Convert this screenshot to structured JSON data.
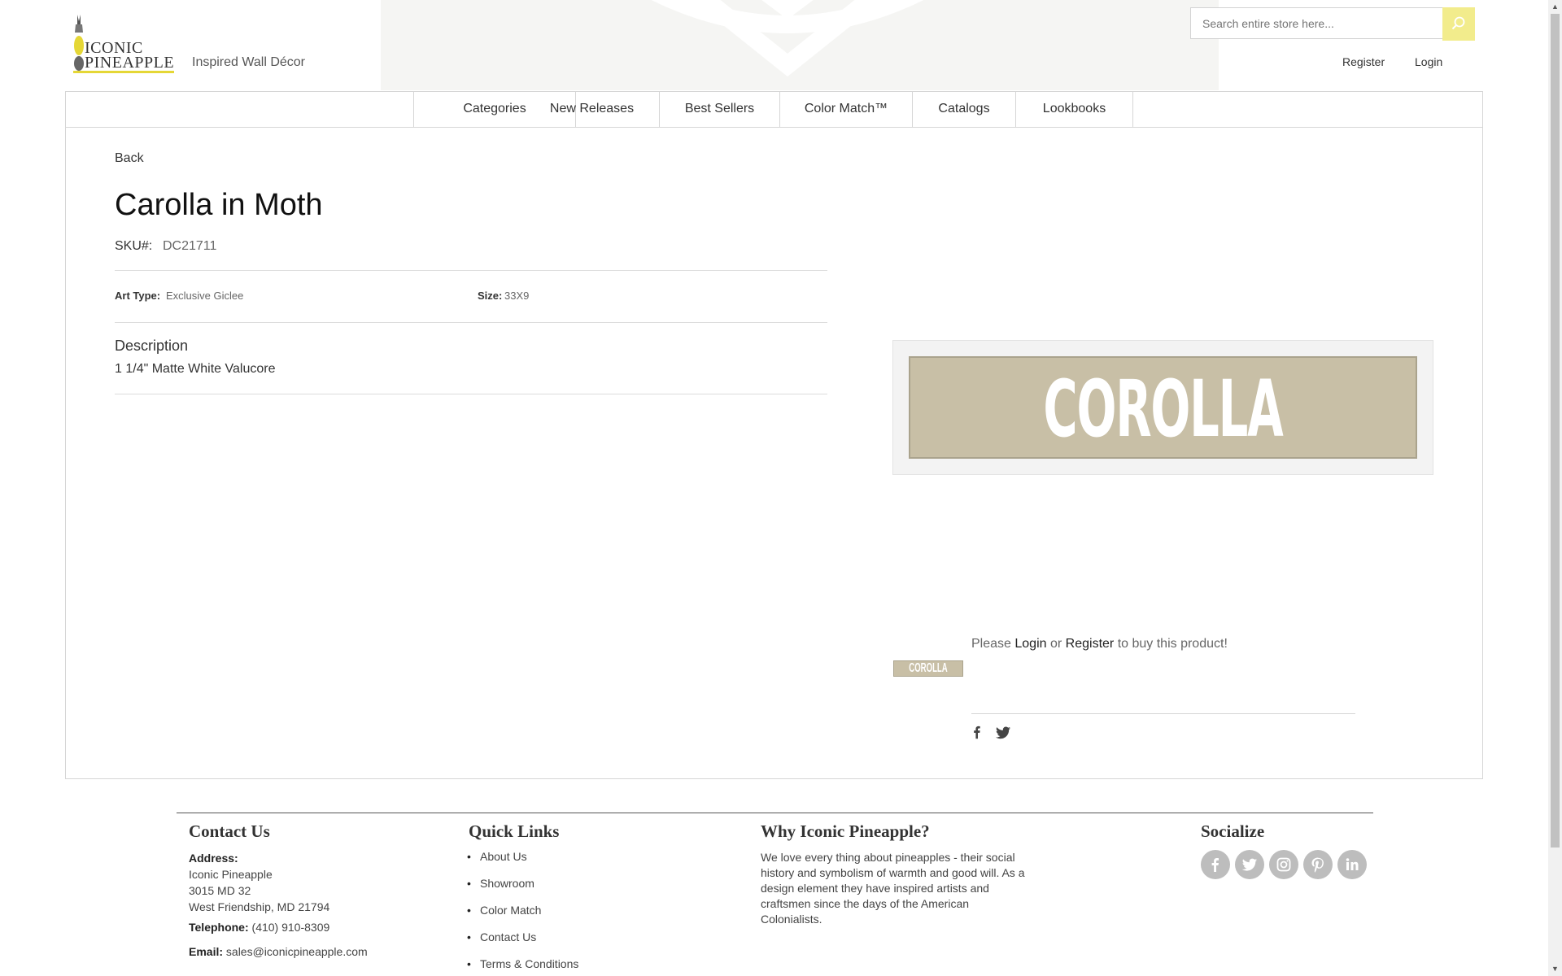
{
  "header": {
    "logo_line1": "ICONIC",
    "logo_line2": "PINEAPPLE",
    "tagline": "Inspired Wall Décor",
    "search_placeholder": "Search entire store here...",
    "register_label": "Register",
    "login_label": "Login"
  },
  "nav": {
    "items": [
      "Categories",
      "New Releases",
      "Best Sellers",
      "Color Match™",
      "Catalogs",
      "Lookbooks"
    ]
  },
  "product": {
    "back_label": "Back",
    "title": "Carolla in Moth",
    "sku_label": "SKU#:",
    "sku_value": "DC21711",
    "art_type_label": "Art Type:",
    "art_type_value": "Exclusive Giclee",
    "size_label": "Size:",
    "size_value": "33X9",
    "description_heading": "Description",
    "description_text": "1 1/4\" Matte White Valucore",
    "image_word": "COROLLA",
    "thumb_word": "COROLLA"
  },
  "purchase": {
    "prefix": "Please",
    "login_link": "Login",
    "or": "or",
    "register_link": "Register",
    "suffix": "to buy this product!"
  },
  "footer": {
    "contact_heading": "Contact Us",
    "address_label": "Address:",
    "address_line1": "Iconic Pineapple",
    "address_line2": "3015 MD 32",
    "address_line3": "West Friendship, MD 21794",
    "telephone_label": "Telephone:",
    "telephone_value": "(410) 910-8309",
    "email_label": "Email:",
    "email_value": "sales@iconicpineapple.com",
    "quick_links_heading": "Quick Links",
    "quick_links": [
      "About Us",
      "Showroom",
      "Color Match",
      "Contact Us",
      "Terms & Conditions"
    ],
    "why_heading": "Why Iconic Pineapple?",
    "why_text": "We love every thing about pineapples - their social history and symbolism of warmth and good will. As a design element they have inspired artists and craftsmen since the days of the American Colonialists.",
    "socialize_heading": "Socialize",
    "social_icons": [
      "facebook-icon",
      "twitter-icon",
      "instagram-icon",
      "pinterest-icon",
      "linkedin-icon"
    ]
  },
  "colors": {
    "accent_yellow": "#e5d736",
    "search_button": "#f2ec8c",
    "product_mat": "#c8bfa6"
  }
}
